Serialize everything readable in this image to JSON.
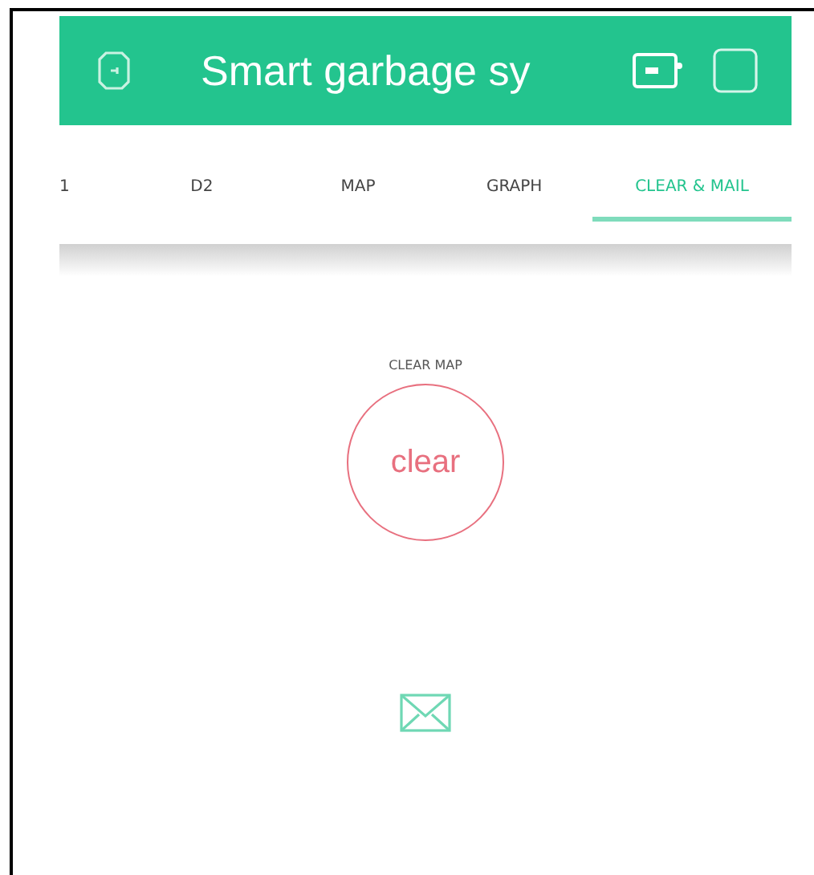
{
  "header": {
    "title": "Smart garbage sy"
  },
  "tabs": [
    {
      "label": "1",
      "selected": false
    },
    {
      "label": "D2",
      "selected": false
    },
    {
      "label": "MAP",
      "selected": false
    },
    {
      "label": "GRAPH",
      "selected": false
    },
    {
      "label": "CLEAR & MAIL",
      "selected": true
    }
  ],
  "clear_widget": {
    "label": "CLEAR MAP",
    "button": "clear"
  }
}
